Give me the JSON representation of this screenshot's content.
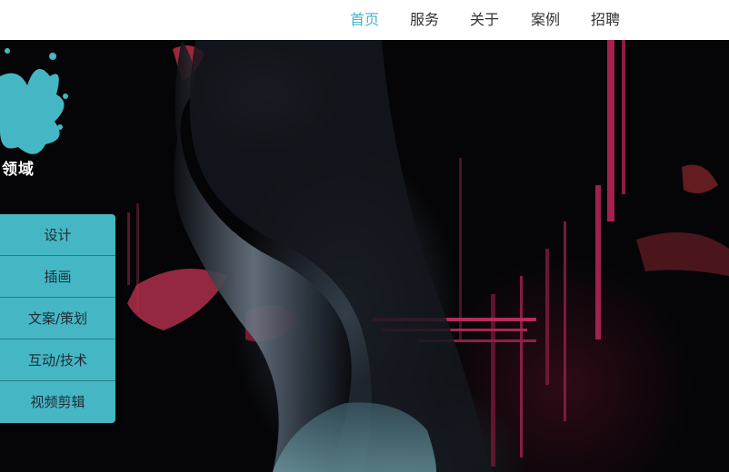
{
  "nav": {
    "items": [
      {
        "label": "首页",
        "active": true
      },
      {
        "label": "服务",
        "active": false
      },
      {
        "label": "关于",
        "active": false
      },
      {
        "label": "案例",
        "active": false
      },
      {
        "label": "招聘",
        "active": false
      }
    ],
    "active_color": "#42b6c2"
  },
  "sidebar": {
    "title": "领域",
    "items": [
      {
        "label": "设计"
      },
      {
        "label": "插画"
      },
      {
        "label": "文案/策划"
      },
      {
        "label": "互动/技术"
      },
      {
        "label": "视频剪辑"
      }
    ],
    "accent_color": "#45b7c4"
  },
  "hero": {
    "image": "dark-silhouette-face-neck-red-glitch"
  }
}
